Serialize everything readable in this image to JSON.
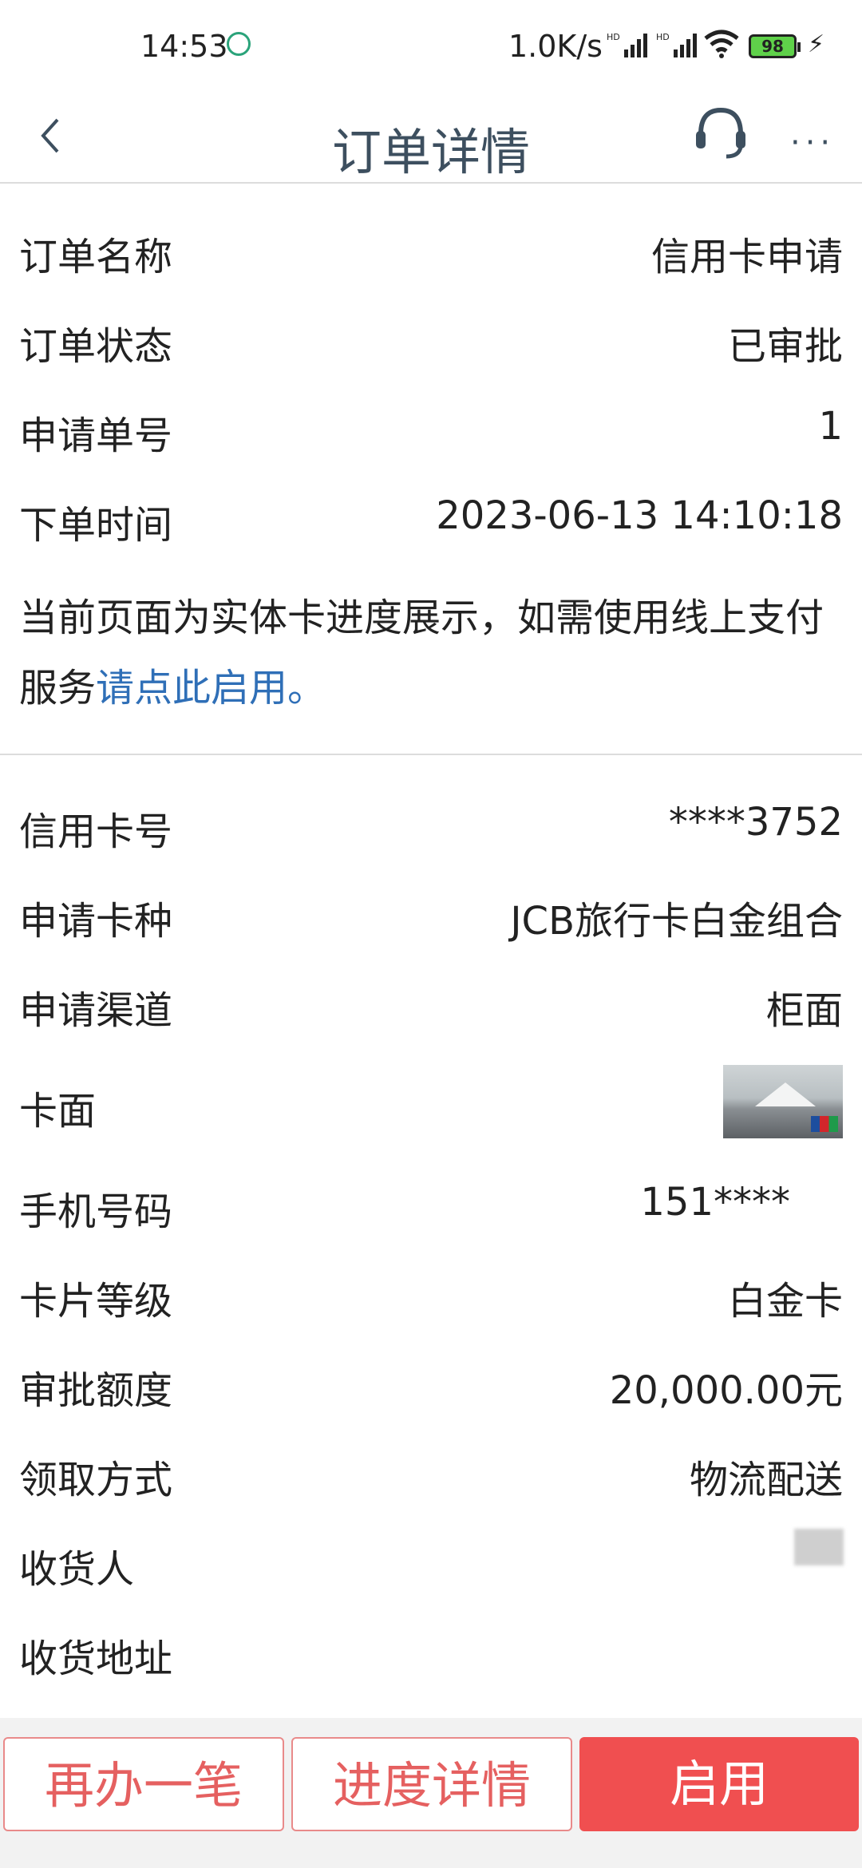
{
  "status_bar": {
    "time": "14:53",
    "network_speed": "1.0K/s",
    "signal1": "HD▂▄▆█",
    "signal2": "HD▂▄▆█",
    "battery": "98",
    "charging": "⚡"
  },
  "nav": {
    "title": "订单详情",
    "back_icon": "chevron-left",
    "service_icon": "headset",
    "more_label": "···"
  },
  "order": {
    "name_label": "订单名称",
    "name_value": "信用卡申请",
    "status_label": "订单状态",
    "status_value": "已审批",
    "number_label": "申请单号",
    "number_value": "1",
    "time_label": "下单时间",
    "time_value": "2023-06-13 14:10:18"
  },
  "notice": {
    "text": "当前页面为实体卡进度展示，如需使用线上支付服务",
    "link": "请点此启用。"
  },
  "card": {
    "card_no_label": "信用卡号",
    "card_no_value": "****3752",
    "type_label": "申请卡种",
    "type_value": "JCB旅行卡白金组合",
    "channel_label": "申请渠道",
    "channel_value": "柜面",
    "face_label": "卡面",
    "phone_label": "手机号码",
    "phone_value": "151****",
    "level_label": "卡片等级",
    "level_value": "白金卡",
    "limit_label": "审批额度",
    "limit_value": "20,000.00元",
    "pickup_label": "领取方式",
    "pickup_value": "物流配送",
    "receiver_label": "收货人",
    "address_label": "收货地址"
  },
  "buttons": {
    "again": "再办一笔",
    "progress": "进度详情",
    "enable": "启用"
  },
  "colors": {
    "link": "#2f6fb7",
    "accent_red": "#f04f50",
    "outline_red": "#e98a8a"
  }
}
